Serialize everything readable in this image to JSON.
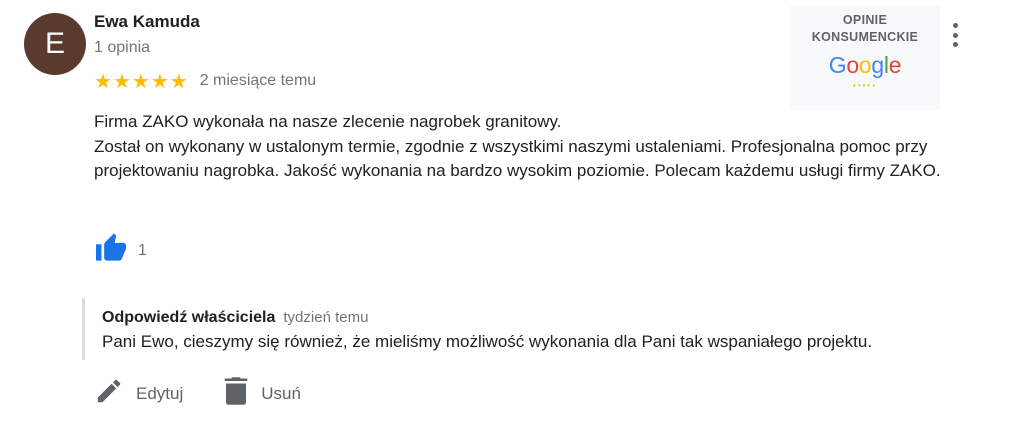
{
  "reviewer": {
    "initial": "E",
    "name": "Ewa Kamuda",
    "review_count": "1 opinia",
    "avatar_color": "#5b3a2e"
  },
  "rating": {
    "stars": 5,
    "max": 5,
    "date": "2 miesiące temu",
    "star_color": "#fbbc04"
  },
  "badge": {
    "title_line1": "OPINIE",
    "title_line2": "KONSUMENCKIE",
    "logo_text": "Google",
    "dots": "•••••"
  },
  "review": {
    "line1": "Firma ZAKO wykonała na nasze zlecenie nagrobek granitowy.",
    "line2": "Został on wykonany w ustalonym termie, zgodnie z wszystkimi naszymi ustaleniami. Profesjonalna pomoc przy projektowaniu nagrobka. Jakość wykonania na bardzo wysokim poziomie.  Polecam każdemu usługi firmy ZAKO."
  },
  "likes": {
    "count": "1",
    "icon": "thumbs-up-icon",
    "color": "#1a73e8"
  },
  "reply": {
    "owner_label": "Odpowiedź właściciela",
    "date": "tydzień temu",
    "text": "Pani Ewo, cieszymy się również, że mieliśmy możliwość wykonania dla Pani tak wspaniałego projektu."
  },
  "actions": {
    "edit_label": "Edytuj",
    "edit_icon": "pencil-icon",
    "delete_label": "Usuń",
    "delete_icon": "trash-icon"
  }
}
